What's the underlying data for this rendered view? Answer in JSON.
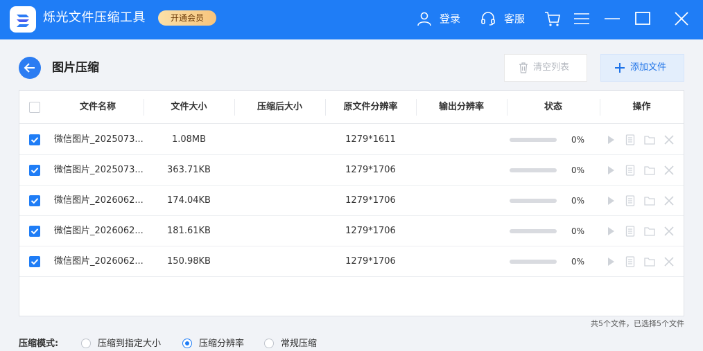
{
  "app": {
    "title": "烁光文件压缩工具",
    "vip_label": "开通会员"
  },
  "titlebar": {
    "login_label": "登录",
    "service_label": "客服",
    "icons": [
      "user-icon",
      "headset-icon",
      "cart-icon",
      "menu-icon",
      "minimize-icon",
      "maximize-icon",
      "close-icon"
    ]
  },
  "header": {
    "title": "图片压缩",
    "clear_label": "清空列表",
    "add_label": "添加文件"
  },
  "table": {
    "columns": [
      "文件名称",
      "文件大小",
      "压缩后大小",
      "原文件分辨率",
      "输出分辨率",
      "状态",
      "操作"
    ],
    "rows": [
      {
        "name": "微信图片_2025073...",
        "size": "1.08MB",
        "compressed": "",
        "resolution": "1279*1611",
        "output": "",
        "progress": "0%",
        "checked": true
      },
      {
        "name": "微信图片_2025073...",
        "size": "363.71KB",
        "compressed": "",
        "resolution": "1279*1706",
        "output": "",
        "progress": "0%",
        "checked": true
      },
      {
        "name": "微信图片_2026062...",
        "size": "174.04KB",
        "compressed": "",
        "resolution": "1279*1706",
        "output": "",
        "progress": "0%",
        "checked": true
      },
      {
        "name": "微信图片_2026062...",
        "size": "181.61KB",
        "compressed": "",
        "resolution": "1279*1706",
        "output": "",
        "progress": "0%",
        "checked": true
      },
      {
        "name": "微信图片_2026062...",
        "size": "150.98KB",
        "compressed": "",
        "resolution": "1279*1706",
        "output": "",
        "progress": "0%",
        "checked": true
      }
    ]
  },
  "summary": "共5个文件，已选择5个文件",
  "mode": {
    "label": "压缩模式:",
    "options": [
      "压缩到指定大小",
      "压缩分辨率",
      "常规压缩"
    ],
    "selected": "压缩分辨率"
  },
  "colors": {
    "accent": "#1f7df6",
    "titlebar": "#1f7df6",
    "vip": "#f7c47c"
  }
}
